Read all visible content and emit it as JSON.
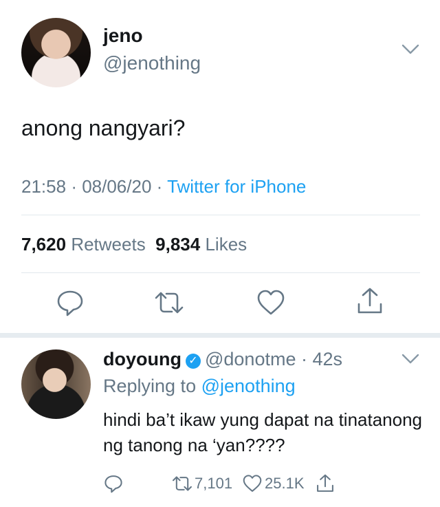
{
  "main_tweet": {
    "display_name": "jeno",
    "handle": "@jenothing",
    "text": "anong nangyari?",
    "time": "21:58",
    "date": "08/06/20",
    "source": "Twitter for iPhone",
    "retweets_count": "7,620",
    "retweets_label": "Retweets",
    "likes_count": "9,834",
    "likes_label": "Likes"
  },
  "reply": {
    "display_name": "doyoung",
    "handle": "@donotme",
    "time": "42s",
    "replying_prefix": "Replying to",
    "replying_to": "@jenothing",
    "text": "hindi ba’t ikaw yung dapat na tinatanong ng tanong na ‘yan????",
    "retweet_count": "7,101",
    "like_count": "25.1K"
  },
  "icons": {
    "menu": "chevron-down-icon",
    "reply": "reply-icon",
    "retweet": "retweet-icon",
    "like": "heart-icon",
    "share": "share-icon",
    "verified": "verified-badge-icon"
  },
  "colors": {
    "text": "#14171a",
    "secondary": "#657786",
    "link": "#1da1f2",
    "divider": "#e1e8ed"
  }
}
